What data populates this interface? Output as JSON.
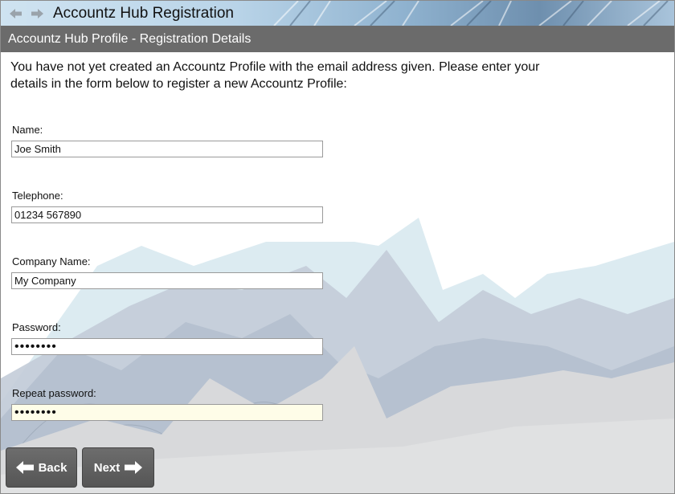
{
  "window": {
    "title": "Accountz Hub Registration"
  },
  "header": {
    "title": "Accountz Hub Profile - Registration Details"
  },
  "intro": {
    "text": "You have not yet created an Accountz Profile with the email address given. Please enter your details in the form below to register a new Accountz Profile:"
  },
  "form": {
    "name": {
      "label": "Name:",
      "value": "Joe Smith"
    },
    "telephone": {
      "label": "Telephone:",
      "value": "01234 567890"
    },
    "company": {
      "label": "Company Name:",
      "value": "My Company"
    },
    "password": {
      "label": "Password:",
      "value": "••••••••"
    },
    "repeat_password": {
      "label": "Repeat password:",
      "value": "••••••••"
    }
  },
  "buttons": {
    "back_label": "Back",
    "next_label": "Next"
  },
  "icons": {
    "back_nav": "arrow-left-icon",
    "forward_nav": "arrow-right-icon",
    "back_button": "arrow-left-icon",
    "next_button": "arrow-right-icon"
  },
  "colors": {
    "header_bg": "#6b6b6b",
    "button_bg": "#5f5f5f",
    "focused_field_bg": "#fefde8"
  }
}
